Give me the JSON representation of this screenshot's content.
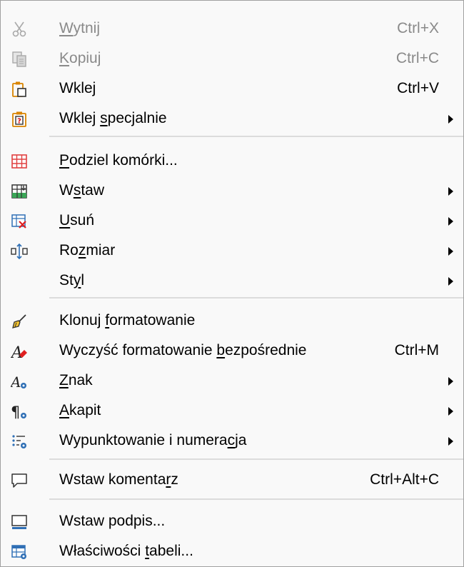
{
  "menu": {
    "cut": {
      "pre": "",
      "u": "W",
      "post": "ytnij",
      "shortcut": "Ctrl+X",
      "disabled": true,
      "icon": "scissors-icon"
    },
    "copy": {
      "pre": "",
      "u": "K",
      "post": "opiuj",
      "shortcut": "Ctrl+C",
      "disabled": true,
      "icon": "copy-icon"
    },
    "paste": {
      "pre": "Wkle",
      "u": "j",
      "post": "",
      "shortcut": "Ctrl+V",
      "icon": "paste-icon"
    },
    "paste_special": {
      "pre": "Wklej ",
      "u": "s",
      "post": "pecjalnie",
      "icon": "paste-special-icon"
    },
    "split_cells": {
      "pre": "",
      "u": "P",
      "post": "odziel komórki...",
      "icon": "split-cells-icon"
    },
    "insert": {
      "pre": "W",
      "u": "s",
      "post": "taw",
      "icon": "insert-table-icon"
    },
    "delete": {
      "pre": "",
      "u": "U",
      "post": "suń",
      "icon": "delete-table-icon"
    },
    "size": {
      "pre": "Ro",
      "u": "z",
      "post": "miar",
      "icon": "resize-icon"
    },
    "style": {
      "pre": "St",
      "u": "y",
      "post": "l"
    },
    "clone_formatting": {
      "pre": "Klonuj ",
      "u": "f",
      "post": "ormatowanie",
      "icon": "paintbrush-icon"
    },
    "clear_formatting": {
      "pre": "Wyczyść formatowanie ",
      "u": "b",
      "post": "ezpośrednie",
      "shortcut": "Ctrl+M",
      "icon": "clear-formatting-icon"
    },
    "character": {
      "pre": "",
      "u": "Z",
      "post": "nak",
      "icon": "character-icon"
    },
    "paragraph": {
      "pre": "",
      "u": "A",
      "post": "kapit",
      "icon": "paragraph-icon"
    },
    "bullets": {
      "pre": "Wypunktowanie i numera",
      "u": "c",
      "post": "ja",
      "icon": "bullets-numbering-icon"
    },
    "comment": {
      "pre": "Wstaw komenta",
      "u": "r",
      "post": "z",
      "shortcut": "Ctrl+Alt+C",
      "icon": "comment-icon"
    },
    "caption": {
      "pre": "Wstaw podpis...",
      "u": "",
      "post": "",
      "icon": "caption-icon"
    },
    "table_properties": {
      "pre": "Właściwości ",
      "u": "t",
      "post": "abeli...",
      "icon": "table-properties-icon"
    }
  },
  "colors": {
    "background": "#f9f9f9",
    "border": "#a0a0a0",
    "disabled_text": "#8a8a8a",
    "separator": "#dcdcdc"
  }
}
